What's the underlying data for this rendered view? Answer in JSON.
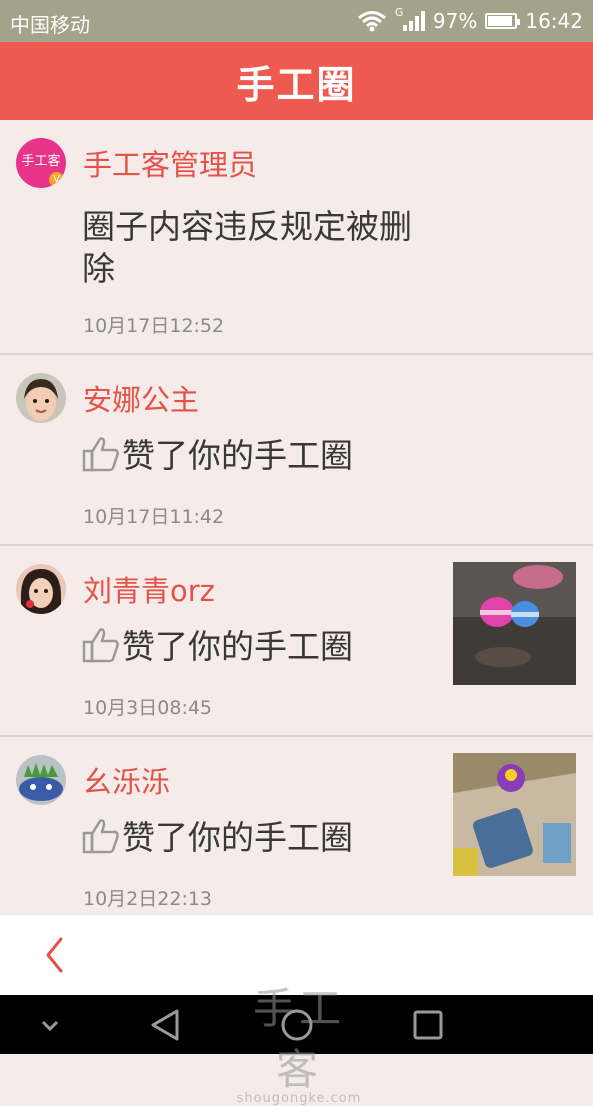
{
  "status_bar": {
    "carrier": "中国移动",
    "network_type": "G",
    "battery": "97%",
    "time": "16:42"
  },
  "header": {
    "title": "手工圈"
  },
  "notifications": [
    {
      "name": "手工客管理员",
      "content": "圈子内容违反规定被删除",
      "time": "10月17日12:52",
      "avatar_text": "手工客",
      "badge": "V"
    },
    {
      "name": "安娜公主",
      "content": "赞了你的手工圈",
      "time": "10月17日11:42"
    },
    {
      "name": "刘青青orz",
      "content": "赞了你的手工圈",
      "time": "10月3日08:45"
    },
    {
      "name": "幺泺泺",
      "content": "赞了你的手工圈",
      "time": "10月2日22:13"
    }
  ],
  "watermark": {
    "main": "手工客",
    "sub": "shougongke.com"
  },
  "colors": {
    "accent": "#ee5a4f",
    "name": "#e4524a",
    "background": "#f5ecea"
  }
}
